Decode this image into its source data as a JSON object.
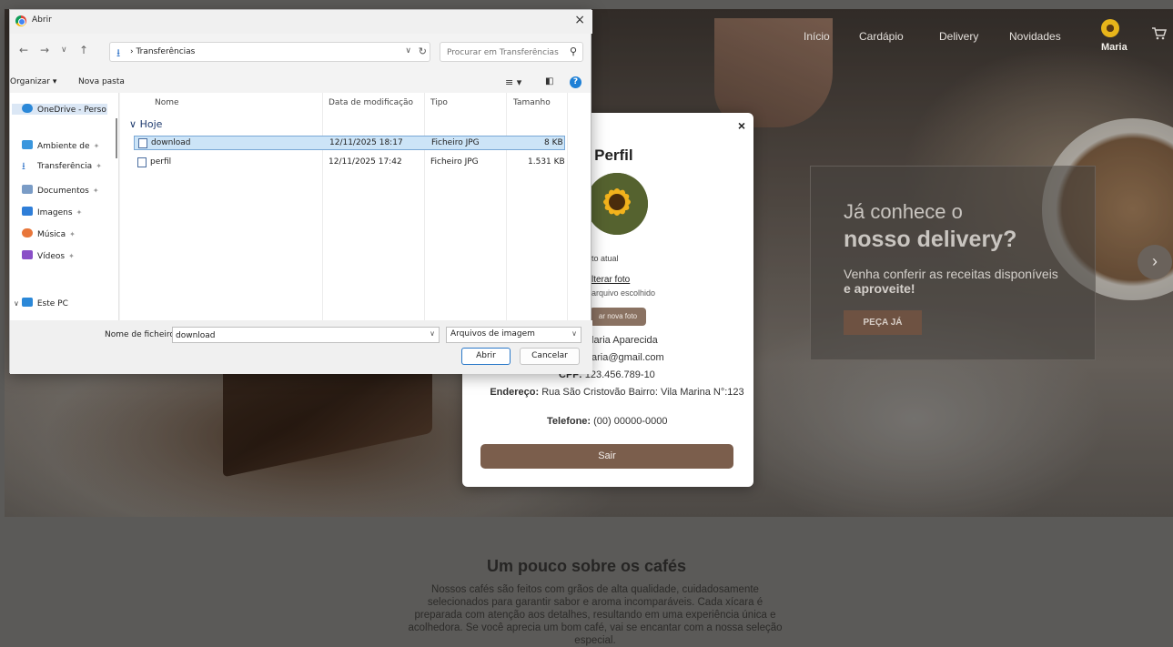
{
  "site": {
    "nav": {
      "inicio": "Início",
      "cardapio": "Cardápio",
      "delivery": "Delivery",
      "novidades": "Novidades"
    },
    "user": {
      "name": "Maria"
    },
    "promo": {
      "line1": "Já conhece o",
      "line2": "nosso delivery?",
      "text": "Venha conferir as receitas disponíveis",
      "text_bold": "e aproveite!",
      "cta": "PEÇA JÁ"
    },
    "carousel_next": "›",
    "about": {
      "title": "Um pouco sobre os cafés",
      "text": "Nossos cafés são feitos com grãos de alta qualidade, cuidadosamente selecionados para garantir sabor e aroma incomparáveis. Cada xícara é preparada com atenção aos detalhes, resultando em uma experiência única e acolhedora. Se você aprecia um bom café, vai se encantar com a nossa seleção especial."
    }
  },
  "profile_modal": {
    "close": "×",
    "title": "u Perfil",
    "photo_caption": "oto atual",
    "change_photo": "lterar foto",
    "file_status": "arquivo escolhido",
    "upload_button": "ar nova foto",
    "name_value": "laria Aparecida",
    "email_value": "aria@gmail.com",
    "cpf_label": "CPF:",
    "cpf_value": "123.456.789-10",
    "address_label": "Endereço:",
    "address_value": "Rua São Cristovão Bairro: Vila Marina N°:123",
    "phone_label": "Telefone:",
    "phone_value": "(00) 00000-0000",
    "logout": "Sair"
  },
  "file_dialog": {
    "title": "Abrir",
    "close": "×",
    "breadcrumb": "Transferências",
    "search_placeholder": "Procurar em Transferências",
    "toolbar": {
      "organize": "Organizar ▾",
      "new_folder": "Nova pasta"
    },
    "columns": {
      "name": "Nome",
      "modified": "Data de modificação",
      "type": "Tipo",
      "size": "Tamanho"
    },
    "group": "Hoje",
    "files": [
      {
        "name": "download",
        "modified": "12/11/2025 18:17",
        "type": "Ficheiro JPG",
        "size": "8 KB",
        "selected": true
      },
      {
        "name": "perfil",
        "modified": "12/11/2025 17:42",
        "type": "Ficheiro JPG",
        "size": "1.531 KB",
        "selected": false
      }
    ],
    "sidebar": [
      {
        "label": "OneDrive - Perso",
        "icon": "onedrive-icon",
        "color": "#2b88d8"
      },
      {
        "label": "Ambiente de",
        "icon": "desktop-icon",
        "color": "#3a96dd"
      },
      {
        "label": "Transferência",
        "icon": "download-icon",
        "color": "#3375c9"
      },
      {
        "label": "Documentos",
        "icon": "documents-icon",
        "color": "#7a9cc6"
      },
      {
        "label": "Imagens",
        "icon": "pictures-icon",
        "color": "#2f7ed8"
      },
      {
        "label": "Música",
        "icon": "music-icon",
        "color": "#e8763a"
      },
      {
        "label": "Vídeos",
        "icon": "videos-icon",
        "color": "#8a4fc7"
      },
      {
        "label": "Este PC",
        "icon": "this-pc-icon",
        "color": "#2b88d8"
      }
    ],
    "filename_label": "Nome de ficheiro:",
    "filename_value": "download",
    "filetype": "Arquivos de imagem",
    "open_button": "Abrir",
    "cancel_button": "Cancelar"
  }
}
